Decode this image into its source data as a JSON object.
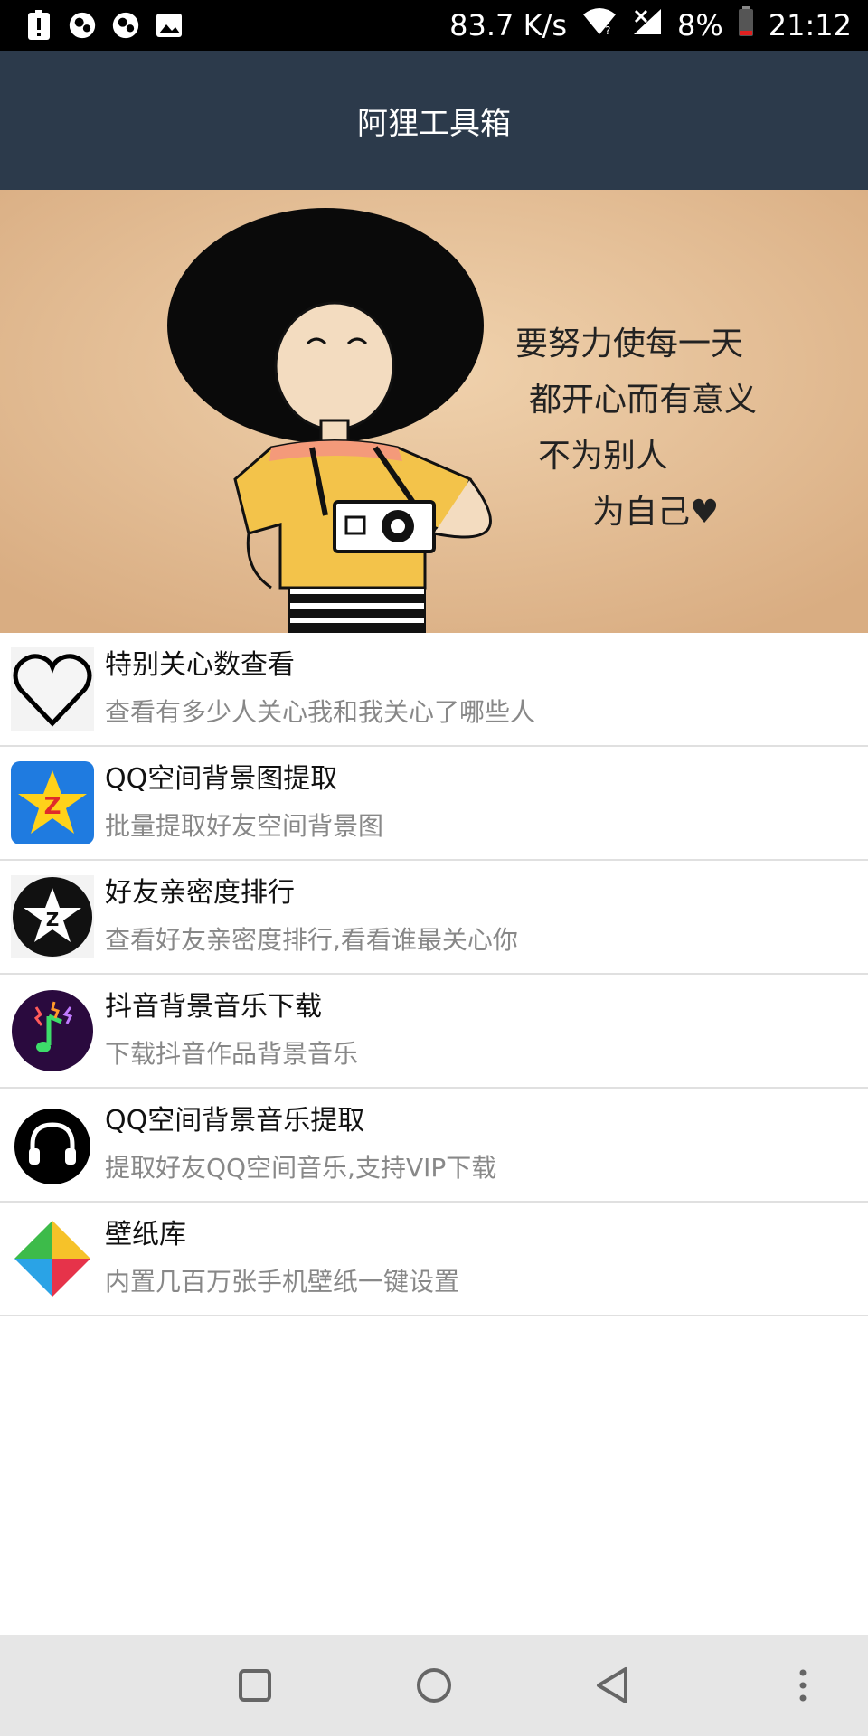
{
  "status_bar": {
    "net_speed": "83.7 K/s",
    "battery_pct": "8%",
    "time": "21:12"
  },
  "header": {
    "title": "阿狸工具箱"
  },
  "banner": {
    "text_lines": [
      "要努力使每一天",
      "都开心而有意义",
      "不为别人",
      "为自己♥"
    ]
  },
  "items": [
    {
      "title": "特别关心数查看",
      "subtitle": "查看有多少人关心我和我关心了哪些人",
      "icon": "heart-icon"
    },
    {
      "title": "QQ空间背景图提取",
      "subtitle": "批量提取好友空间背景图",
      "icon": "qzone-star-icon"
    },
    {
      "title": "好友亲密度排行",
      "subtitle": "查看好友亲密度排行,看看谁最关心你",
      "icon": "qzone-round-icon"
    },
    {
      "title": "抖音背景音乐下载",
      "subtitle": "下载抖音作品背景音乐",
      "icon": "music-note-icon"
    },
    {
      "title": "QQ空间背景音乐提取",
      "subtitle": "提取好友QQ空间音乐,支持VIP下载",
      "icon": "headphones-icon"
    },
    {
      "title": "壁纸库",
      "subtitle": "内置几百万张手机壁纸一键设置",
      "icon": "wallpaper-pinwheel-icon"
    }
  ],
  "colors": {
    "app_bar": "#2c3a4b",
    "banner_bg": "#e8c39a",
    "divider": "#e0e0e0",
    "subtitle": "#888888"
  }
}
